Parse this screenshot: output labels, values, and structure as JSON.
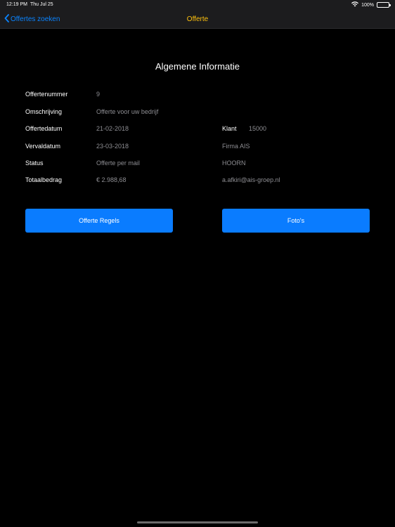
{
  "status_bar": {
    "time": "12:19 PM",
    "date": "Thu Jul 25",
    "battery": "100%"
  },
  "nav": {
    "back_label": "Offertes zoeken",
    "title": "Offerte"
  },
  "section": {
    "title": "Algemene Informatie"
  },
  "fields": {
    "nummer": {
      "label": "Offertenummer",
      "value": "9"
    },
    "omschrijving": {
      "label": "Omschrijving",
      "value": "Offerte voor uw bedrijf"
    },
    "datum": {
      "label": "Offertedatum",
      "value": "21-02-2018"
    },
    "vervaldatum": {
      "label": "Vervaldatum",
      "value": "23-03-2018"
    },
    "status": {
      "label": "Status",
      "value": "Offerte per mail"
    },
    "totaal": {
      "label": "Totaalbedrag",
      "value": "€ 2.988,68"
    }
  },
  "klant": {
    "label": "Klant",
    "number": "15000",
    "name": "Firma AIS",
    "city": "HOORN",
    "email": "a.afkiri@ais-groep.nl"
  },
  "buttons": {
    "regels": "Offerte Regels",
    "fotos": "Foto's"
  }
}
